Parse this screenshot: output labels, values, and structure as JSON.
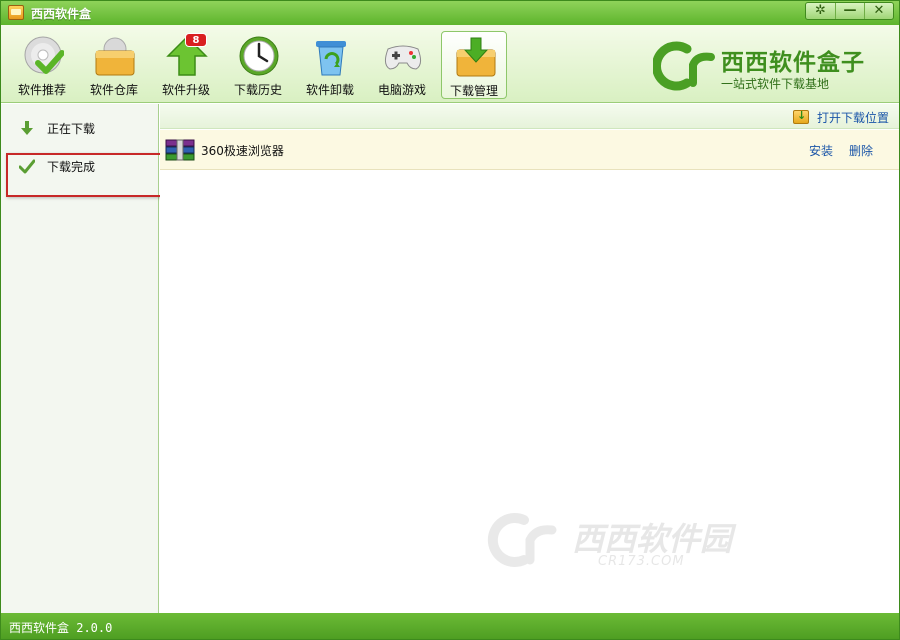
{
  "window": {
    "title": "西西软件盒"
  },
  "toolbar": {
    "items": [
      {
        "label": "软件推荐",
        "icon": "disc-check-icon"
      },
      {
        "label": "软件仓库",
        "icon": "box-icon"
      },
      {
        "label": "软件升级",
        "icon": "up-arrow-icon",
        "badge": "8"
      },
      {
        "label": "下载历史",
        "icon": "clock-icon"
      },
      {
        "label": "软件卸载",
        "icon": "recycle-bin-icon"
      },
      {
        "label": "电脑游戏",
        "icon": "gamepad-icon"
      },
      {
        "label": "下载管理",
        "icon": "download-box-icon",
        "active": true
      }
    ]
  },
  "brand": {
    "title": "西西软件盒子",
    "subtitle": "一站式软件下载基地"
  },
  "sidebar": {
    "items": [
      {
        "label": "正在下载",
        "icon": "down-arrow-icon"
      },
      {
        "label": "下载完成",
        "icon": "check-icon"
      }
    ]
  },
  "main": {
    "open_location": "打开下载位置",
    "rows": [
      {
        "name": "360极速浏览器",
        "install": "安装",
        "delete": "删除",
        "icon": "archive-icon"
      }
    ]
  },
  "watermark": {
    "text": "西西软件园",
    "domain": "CR173.COM"
  },
  "status": {
    "text": "西西软件盒 2.0.0"
  },
  "colors": {
    "accent": "#5db42c",
    "link": "#1a55a8",
    "highlight": "#c72828",
    "row_bg": "#fcf9e2"
  }
}
